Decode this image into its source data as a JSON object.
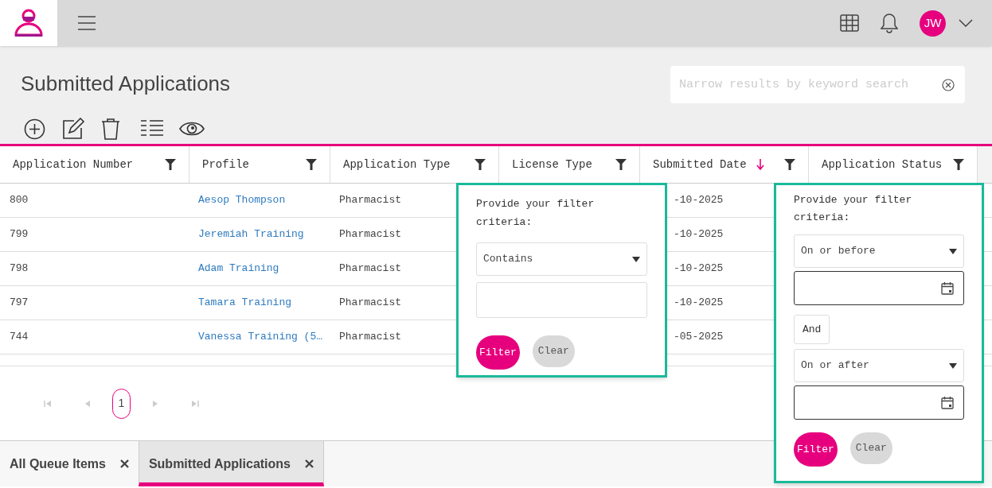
{
  "header": {
    "avatar_initials": "JW"
  },
  "page": {
    "title": "Submitted Applications",
    "search": {
      "placeholder": "Narrow results by keyword search"
    }
  },
  "table": {
    "columns": [
      {
        "label": "Application Number",
        "sorted": false
      },
      {
        "label": "Profile",
        "sorted": false
      },
      {
        "label": "Application Type",
        "sorted": false
      },
      {
        "label": "License Type",
        "sorted": false
      },
      {
        "label": "Submitted Date",
        "sorted": true
      },
      {
        "label": "Application Status",
        "sorted": false
      }
    ],
    "rows": [
      {
        "number": "800",
        "profile": "Aesop Thompson",
        "type": "Pharmacist",
        "date": "-10-2025"
      },
      {
        "number": "799",
        "profile": "Jeremiah Training",
        "type": "Pharmacist",
        "date": "-10-2025"
      },
      {
        "number": "798",
        "profile": "Adam Training",
        "type": "Pharmacist",
        "date": "-10-2025"
      },
      {
        "number": "797",
        "profile": "Tamara Training",
        "type": "Pharmacist",
        "date": "-10-2025"
      },
      {
        "number": "744",
        "profile": "Vanessa Training (5…",
        "type": "Pharmacist",
        "date": "-05-2025"
      }
    ]
  },
  "pagination": {
    "pages": [
      {
        "label": "1",
        "selected": true
      }
    ]
  },
  "text_filter": {
    "prompt": "Provide your filter criteria:",
    "operator": "Contains",
    "buttons": [
      "Filter",
      "Clear"
    ]
  },
  "date_filter": {
    "prompt": "Provide your filter criteria:",
    "first_operator": "On or before",
    "joiner": "And",
    "second_operator": "On or after",
    "buttons": [
      "Filter",
      "Clear"
    ]
  },
  "bottom_tabs": [
    {
      "label": "All Queue Items",
      "selected": false
    },
    {
      "label": "Submitted Applications",
      "selected": true
    }
  ]
}
